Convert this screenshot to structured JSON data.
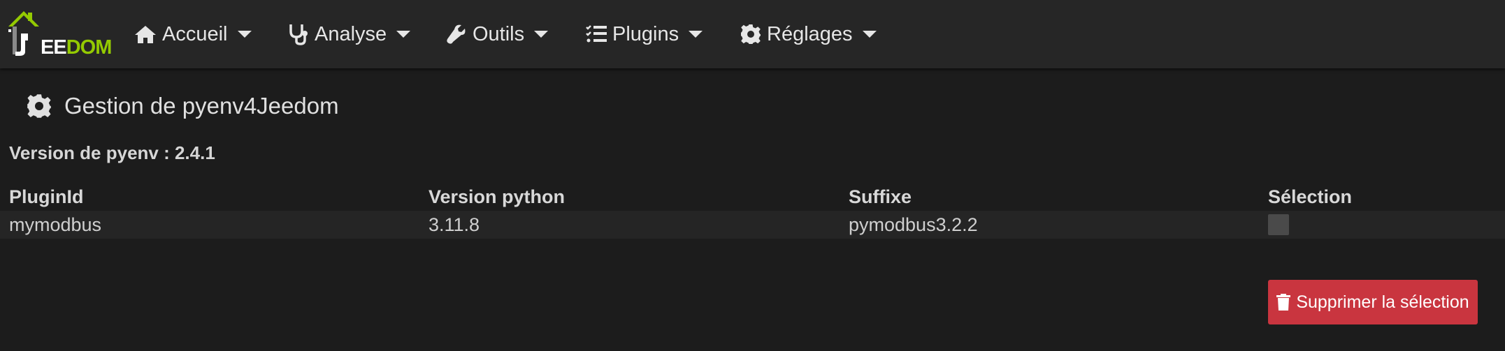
{
  "logo": {
    "text_left": "EE",
    "text_right": "DOM",
    "brand_color": "#94ca02"
  },
  "nav": [
    {
      "label": "Accueil",
      "icon": "home-icon"
    },
    {
      "label": "Analyse",
      "icon": "stethoscope-icon"
    },
    {
      "label": "Outils",
      "icon": "wrench-icon"
    },
    {
      "label": "Plugins",
      "icon": "tasks-list-icon"
    },
    {
      "label": "Réglages",
      "icon": "gear-icon"
    }
  ],
  "page": {
    "title": "Gestion de pyenv4Jeedom",
    "title_icon": "gear-icon",
    "version": "Version de pyenv : 2.4.1"
  },
  "table": {
    "headers": [
      "PluginId",
      "Version python",
      "Suffixe",
      "Sélection"
    ],
    "rows": [
      {
        "plugin_id": "mymodbus",
        "python_version": "3.11.8",
        "suffix": "pymodbus3.2.2",
        "selected": false
      }
    ]
  },
  "actions": {
    "delete_label": "Supprimer la sélection",
    "delete_icon": "trash-icon",
    "delete_color": "#c9353f"
  }
}
